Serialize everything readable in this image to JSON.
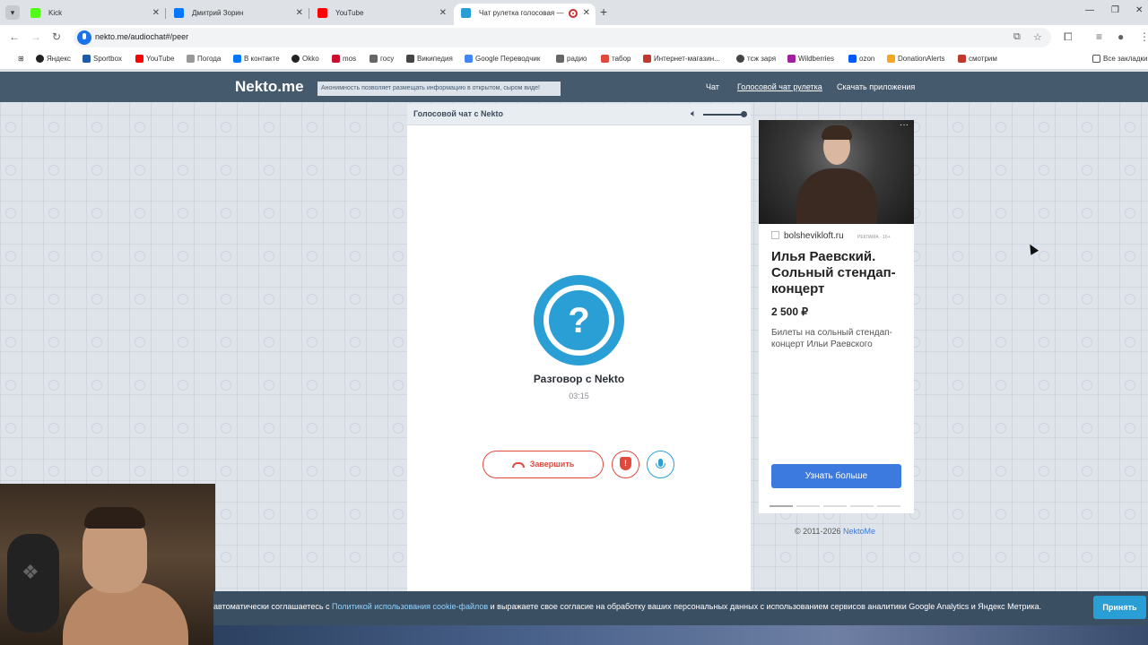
{
  "browser": {
    "tabs": [
      {
        "title": "Kick",
        "favicon_color": "#53fc18"
      },
      {
        "title": "Дмитрий Зорин",
        "favicon_color": "#0077ff"
      },
      {
        "title": "YouTube",
        "favicon_color": "#ff0000"
      },
      {
        "title": "Чат рулетка голосовая — Nekto.me",
        "favicon_color": "#2a9fd6"
      }
    ],
    "url": "nekto.me/audiochat#/peer",
    "bookmarks": [
      {
        "label": "Яндекс",
        "color": "#222"
      },
      {
        "label": "Sportbox",
        "color": "#1e5aa8"
      },
      {
        "label": "YouTube",
        "color": "#ff0000"
      },
      {
        "label": "Погода",
        "color": "#999"
      },
      {
        "label": "В контакте",
        "color": "#0077ff"
      },
      {
        "label": "Okko",
        "color": "#222"
      },
      {
        "label": "mos",
        "color": "#c8102e"
      },
      {
        "label": "госу",
        "color": "#666"
      },
      {
        "label": "Википедия",
        "color": "#444"
      },
      {
        "label": "Google Переводчик",
        "color": "#4285f4"
      },
      {
        "label": "радио",
        "color": "#666"
      },
      {
        "label": "табор",
        "color": "#e04a3c"
      },
      {
        "label": "Интернет-магазин...",
        "color": "#c0392b"
      },
      {
        "label": "тсж заря",
        "color": "#444"
      },
      {
        "label": "Wildberries",
        "color": "#a020a0"
      },
      {
        "label": "ozon",
        "color": "#005bff"
      },
      {
        "label": "DonationAlerts",
        "color": "#f5a623"
      },
      {
        "label": "смотрим",
        "color": "#c0392b"
      }
    ],
    "all_bookmarks": "Все закладки"
  },
  "site": {
    "logo": "Nekto.me",
    "tagline": "Анонимность позволяет размещать информацию в открытом, сыром виде!",
    "nav": [
      "Чат",
      "Голосовой чат рулетка",
      "Скачать приложения"
    ]
  },
  "chat": {
    "header_title": "Голосовой чат с Nekto",
    "volume": 1.0,
    "avatar_symbol": "?",
    "talk_label": "Разговор с Nekto",
    "timer": "03:15",
    "end_button": "Завершить",
    "report_symbol": "!"
  },
  "ad": {
    "domain": "bolshevikloft.ru",
    "label": "РЕКЛАМА · 16+",
    "title": "Илья Раевский. Сольный стендап-концерт",
    "price": "2 500 ₽",
    "description": "Билеты на сольный стендап-концерт Ильи Раевского",
    "cta": "Узнать больше",
    "more_symbol": "···"
  },
  "footer": {
    "copyright": "© 2011-2026",
    "copyright_link": "NektoMe"
  },
  "cookie": {
    "text_before": "автоматически соглашаетесь с",
    "link": "Политикой использования cookie-файлов",
    "text_after": "и выражаете свое согласие на обработку ваших персональных данных с использованием сервисов аналитики Google Analytics и Яндекс Метрика.",
    "accept": "Принять"
  }
}
